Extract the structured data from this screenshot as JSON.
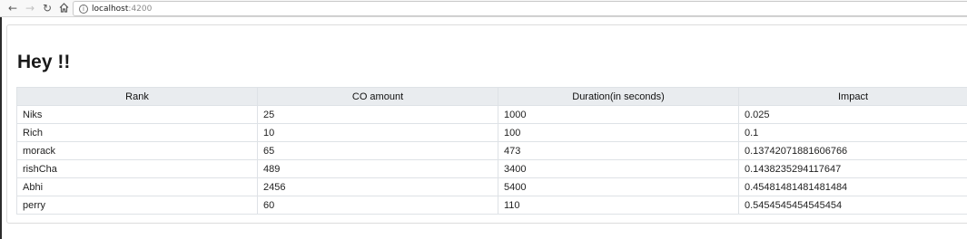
{
  "browser": {
    "back_glyph": "←",
    "forward_glyph": "→",
    "reload_glyph": "↻",
    "url_host": "localhost",
    "url_port": ":4200",
    "info_glyph": "i"
  },
  "page": {
    "title": "Hey !!"
  },
  "table": {
    "columns": [
      "Rank",
      "CO amount",
      "Duration(in seconds)",
      "Impact"
    ],
    "rows": [
      [
        "Niks",
        "25",
        "1000",
        "0.025"
      ],
      [
        "Rich",
        "10",
        "100",
        "0.1"
      ],
      [
        "morack",
        "65",
        "473",
        "0.13742071881606766"
      ],
      [
        "rishCha",
        "489",
        "3400",
        "0.1438235294117647"
      ],
      [
        "Abhi",
        "2456",
        "5400",
        "0.45481481481481484"
      ],
      [
        "perry",
        "60",
        "110",
        "0.5454545454545454"
      ]
    ]
  }
}
